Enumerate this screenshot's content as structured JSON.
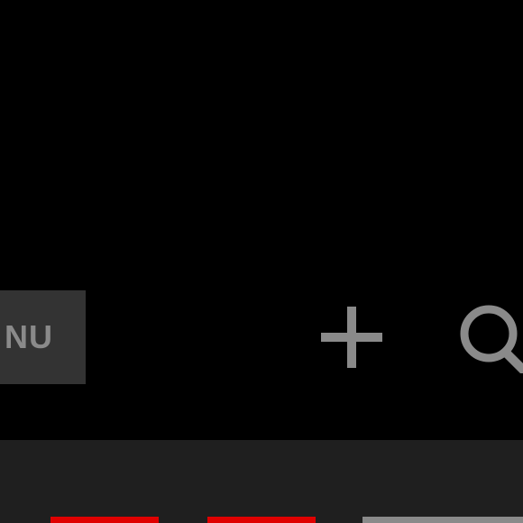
{
  "header": {
    "menu_label": "NU",
    "add_icon": "plus-icon",
    "search_icon": "search-icon"
  },
  "colors": {
    "background": "#000000",
    "menu_bg": "#333333",
    "icon": "#8a8a8a",
    "sub_bar_bg": "#1f1f1f",
    "accent_red": "#e00000",
    "muted_text": "#8a8a8a"
  }
}
